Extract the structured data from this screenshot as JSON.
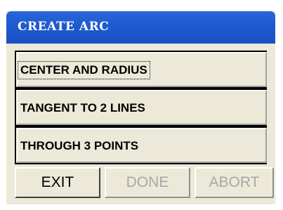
{
  "window": {
    "title": "CREATE ARC",
    "title_color": "#ffffff",
    "titlebar_color": "#1f5ad0"
  },
  "options": [
    {
      "label": "CENTER AND RADIUS",
      "focused": true
    },
    {
      "label": "TANGENT TO 2 LINES",
      "focused": false
    },
    {
      "label": "THROUGH 3 POINTS",
      "focused": false
    }
  ],
  "buttons": {
    "exit": {
      "label": "EXIT",
      "enabled": true
    },
    "done": {
      "label": "DONE",
      "enabled": false
    },
    "abort": {
      "label": "ABORT",
      "enabled": false
    }
  },
  "colors": {
    "dialog_bg": "#ece9d8",
    "disabled_text": "#a8a8a8"
  }
}
